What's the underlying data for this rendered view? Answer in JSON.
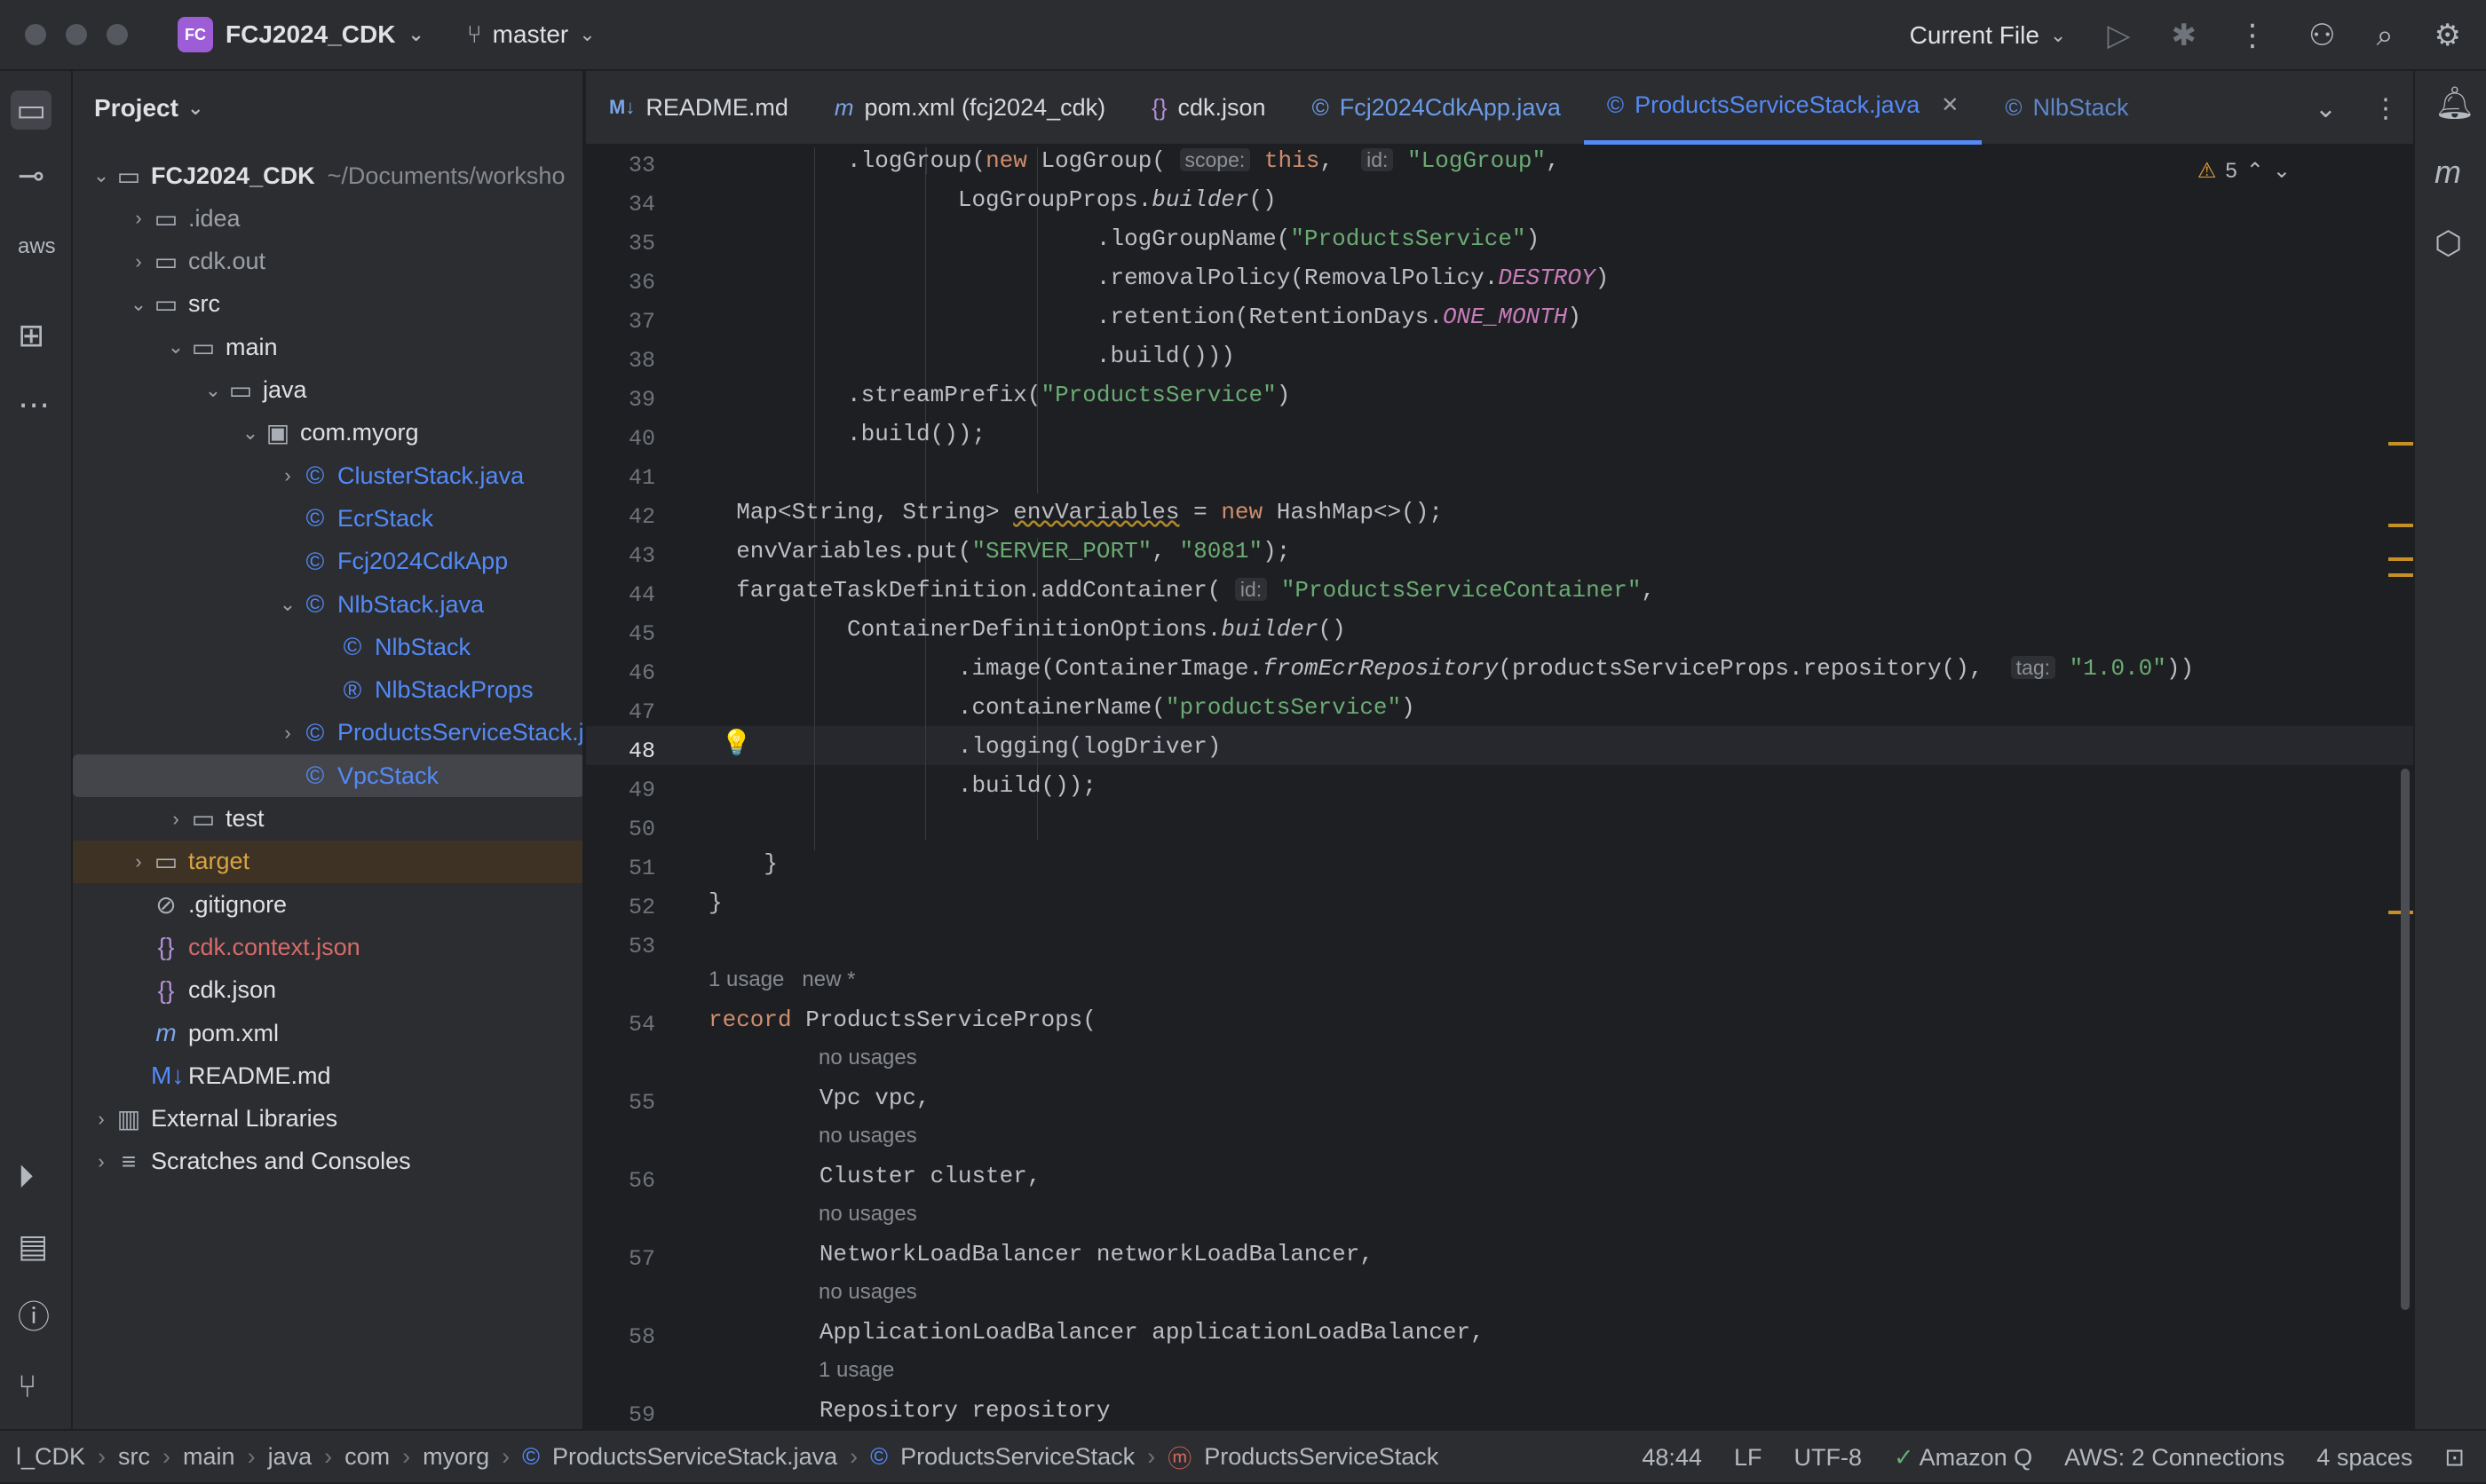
{
  "window": {
    "project_badge": "FC",
    "project_name": "FCJ2024_CDK",
    "branch": "master",
    "run_config": "Current File"
  },
  "project_panel": {
    "title": "Project",
    "tree": [
      {
        "label": "FCJ2024_CDK",
        "extra": "~/Documents/worksho",
        "level": 0,
        "arrow": "v",
        "icon": "folder-icon"
      },
      {
        "label": ".idea",
        "level": 1,
        "arrow": ">",
        "icon": "folder-icon"
      },
      {
        "label": "cdk.out",
        "level": 1,
        "arrow": ">",
        "icon": "folder-icon"
      },
      {
        "label": "src",
        "level": 1,
        "arrow": "v",
        "icon": "folder-icon"
      },
      {
        "label": "main",
        "level": 2,
        "arrow": "v",
        "icon": "folder-icon"
      },
      {
        "label": "java",
        "level": 3,
        "arrow": "v",
        "icon": "folder-icon"
      },
      {
        "label": "com.myorg",
        "level": 4,
        "arrow": "v",
        "icon": "package-icon"
      },
      {
        "label": "ClusterStack.java",
        "level": 5,
        "arrow": ">",
        "icon": "class-icon"
      },
      {
        "label": "EcrStack",
        "level": 5,
        "arrow": "",
        "icon": "class-icon"
      },
      {
        "label": "Fcj2024CdkApp",
        "level": 5,
        "arrow": "",
        "icon": "class-icon"
      },
      {
        "label": "NlbStack.java",
        "level": 5,
        "arrow": "v",
        "icon": "class-icon"
      },
      {
        "label": "NlbStack",
        "level": 6,
        "arrow": "",
        "icon": "class-icon"
      },
      {
        "label": "NlbStackProps",
        "level": 6,
        "arrow": "",
        "icon": "record-icon"
      },
      {
        "label": "ProductsServiceStack.j",
        "level": 5,
        "arrow": ">",
        "icon": "class-icon"
      },
      {
        "label": "VpcStack",
        "level": 5,
        "arrow": "",
        "icon": "class-icon"
      },
      {
        "label": "test",
        "level": 2,
        "arrow": ">",
        "icon": "folder-icon"
      },
      {
        "label": "target",
        "level": 1,
        "arrow": ">",
        "icon": "folder-icon"
      },
      {
        "label": ".gitignore",
        "level": 1,
        "arrow": "",
        "icon": "ignore-icon"
      },
      {
        "label": "cdk.context.json",
        "level": 1,
        "arrow": "",
        "icon": "json-icon"
      },
      {
        "label": "cdk.json",
        "level": 1,
        "arrow": "",
        "icon": "json-icon"
      },
      {
        "label": "pom.xml",
        "level": 1,
        "arrow": "",
        "icon": "maven-icon"
      },
      {
        "label": "README.md",
        "level": 1,
        "arrow": "",
        "icon": "markdown-icon"
      },
      {
        "label": "External Libraries",
        "level": 0,
        "arrow": ">",
        "icon": "library-icon"
      },
      {
        "label": "Scratches and Consoles",
        "level": 0,
        "arrow": ">",
        "icon": "scratch-icon"
      }
    ]
  },
  "tabs": [
    {
      "label": "README.md",
      "icon": "M↓"
    },
    {
      "label": "pom.xml (fcj2024_cdk)",
      "icon": "m"
    },
    {
      "label": "cdk.json",
      "icon": "{}"
    },
    {
      "label": "Fcj2024CdkApp.java",
      "icon": "©"
    },
    {
      "label": "ProductsServiceStack.java",
      "icon": "©"
    },
    {
      "label": "NlbStack",
      "icon": "©"
    }
  ],
  "editor": {
    "warnings": "5",
    "current_line": "48",
    "lines": [
      "33",
      "34",
      "35",
      "36",
      "37",
      "38",
      "39",
      "40",
      "41",
      "42",
      "43",
      "44",
      "45",
      "46",
      "47",
      "48",
      "49",
      "50",
      "51",
      "52",
      "53",
      "54",
      "55",
      "56",
      "57",
      "58",
      "59"
    ],
    "hints": {
      "usage1": "1 usage",
      "new": "new *",
      "no_usages": "no usages",
      "one_usage": "1 usage"
    },
    "inlay": {
      "scope": "scope:",
      "id": "id:",
      "tag": "tag:"
    }
  },
  "status": {
    "breadcrumbs": [
      "l_CDK",
      "src",
      "main",
      "java",
      "com",
      "myorg",
      "ProductsServiceStack.java",
      "ProductsServiceStack",
      "ProductsServiceStack"
    ],
    "position": "48:44",
    "line_sep": "LF",
    "encoding": "UTF-8",
    "amazon_q": "Amazon Q",
    "aws": "AWS: 2 Connections",
    "indent": "4 spaces"
  }
}
